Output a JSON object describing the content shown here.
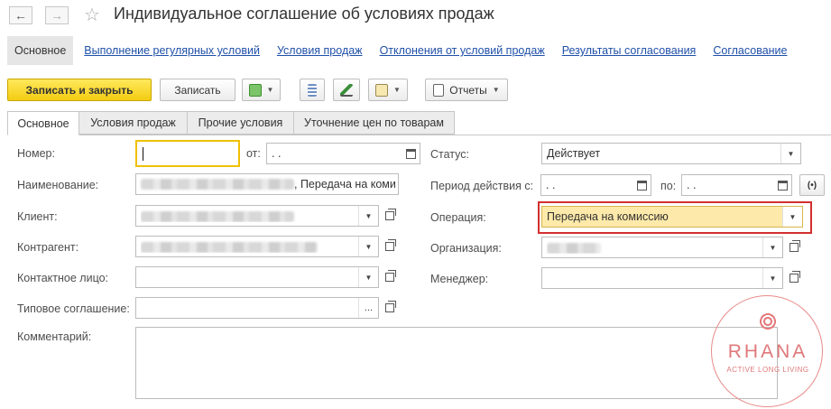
{
  "window": {
    "title": "Индивидуальное соглашение об условиях продаж"
  },
  "form_nav": {
    "active": "Основное",
    "links": [
      "Выполнение регулярных условий",
      "Условия продаж",
      "Отклонения от условий продаж",
      "Результаты согласования",
      "Согласование"
    ]
  },
  "toolbar": {
    "save_close": "Записать и закрыть",
    "save": "Записать",
    "reports": "Отчеты"
  },
  "tabs": [
    "Основное",
    "Условия продаж",
    "Прочие условия",
    "Уточнение цен по товарам"
  ],
  "labels": {
    "number": "Номер:",
    "from": "от:",
    "name": "Наименование:",
    "client": "Клиент:",
    "counterparty": "Контрагент:",
    "contact": "Контактное лицо:",
    "typical": "Типовое соглашение:",
    "comment": "Комментарий:",
    "status": "Статус:",
    "period": "Период действия с:",
    "to": "по:",
    "operation": "Операция:",
    "organization": "Организация:",
    "manager": "Менеджер:"
  },
  "values": {
    "number": "",
    "date": " .  .",
    "name_suffix": ", Передача на коми",
    "status": "Действует",
    "period_from": " .  .",
    "period_to": " .  .",
    "operation": "Передача на комиссию",
    "ellipsis": "..."
  },
  "watermark": {
    "brand": "RHANA",
    "tagline": "ACTIVE LONG LIVING"
  },
  "colors": {
    "primary_button": "#f3cc12",
    "link": "#1f50a8",
    "highlight_field": "#fde9a9",
    "highlight_border": "#d32f2f",
    "focus_border": "#f0c000"
  }
}
